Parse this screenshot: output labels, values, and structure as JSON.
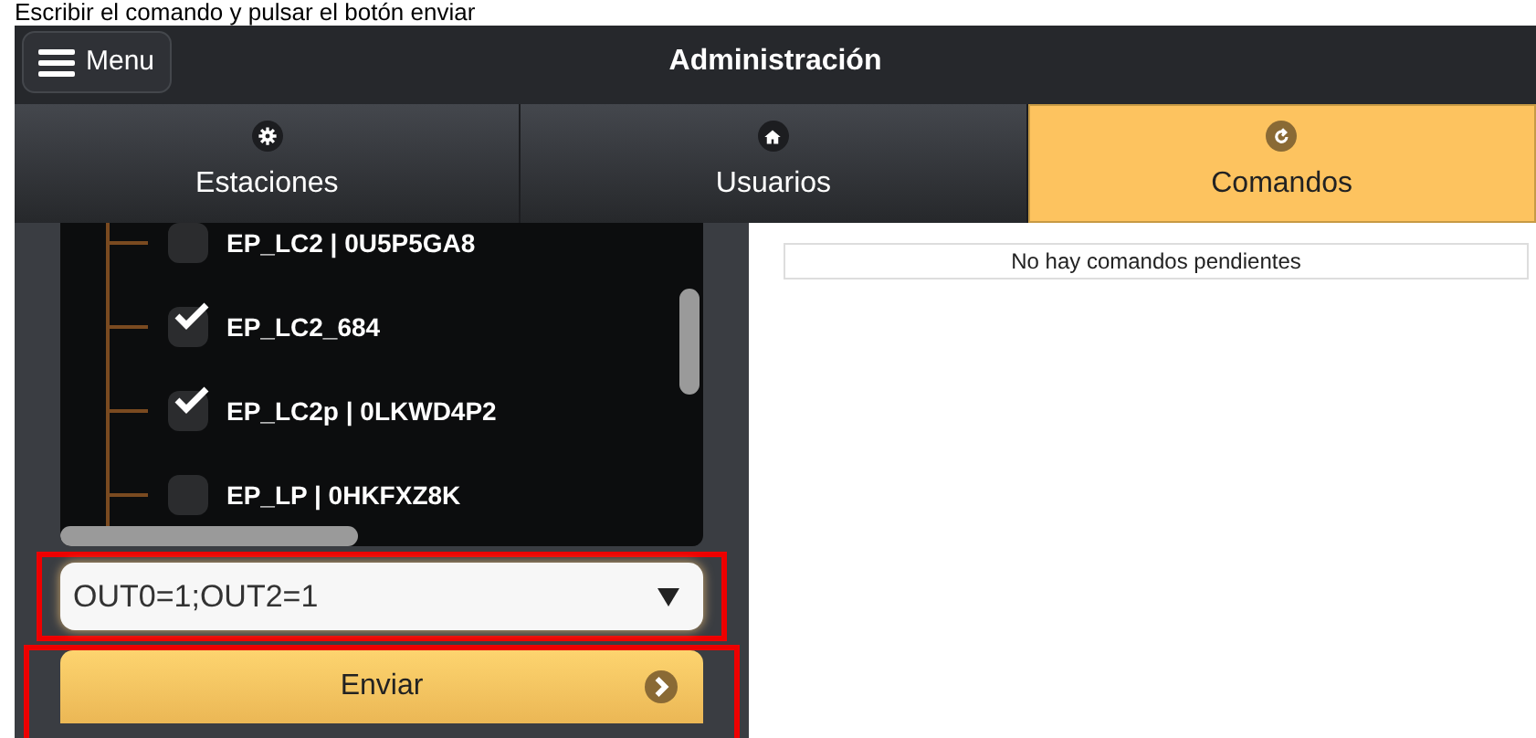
{
  "instruction": "Escribir el comando y pulsar el botón enviar",
  "header": {
    "menu_button": "Menu",
    "title": "Administración"
  },
  "tabs": [
    {
      "label": "Estaciones",
      "kind": "gear",
      "selected": false
    },
    {
      "label": "Usuarios",
      "kind": "home",
      "selected": false
    },
    {
      "label": "Comandos",
      "kind": "redo",
      "selected": true
    }
  ],
  "stations": [
    {
      "label": "EP_LC2 | 0U5P5GA8",
      "checked": false
    },
    {
      "label": "EP_LC2_684",
      "checked": true
    },
    {
      "label": "EP_LC2p | 0LKWD4P2",
      "checked": true
    },
    {
      "label": "EP_LP | 0HKFXZ8K",
      "checked": false
    }
  ],
  "command_field": {
    "value": "OUT0=1;OUT2=1"
  },
  "send_button": "Enviar",
  "pending_notice": "No hay comandos pendientes"
}
